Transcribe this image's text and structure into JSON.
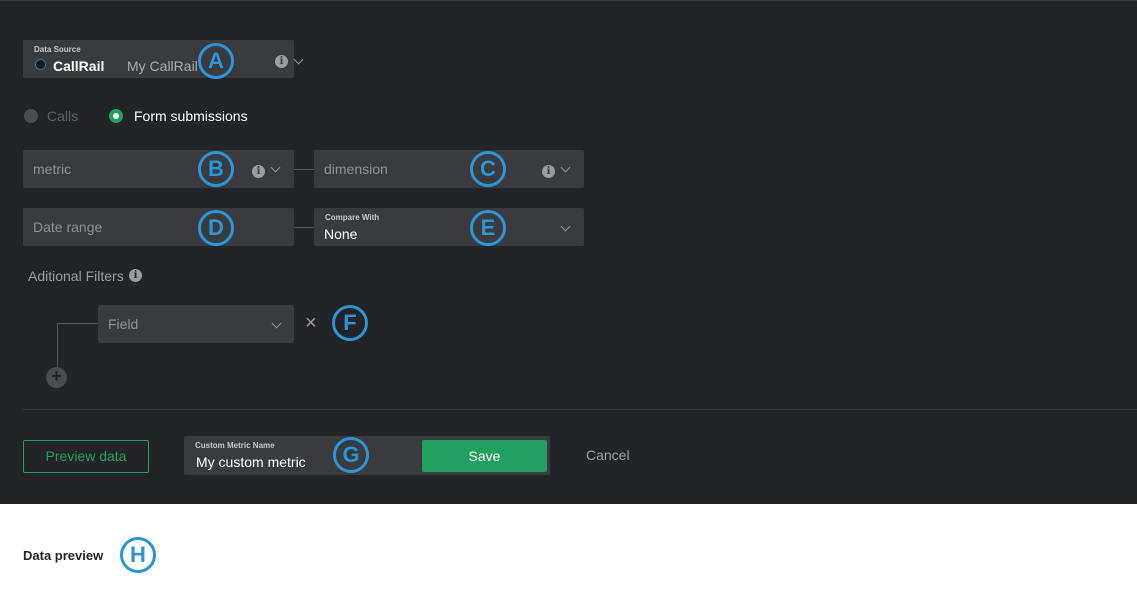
{
  "data_source": {
    "label": "Data Source",
    "provider": "CallRail",
    "account": "My CallRail",
    "badge": "A"
  },
  "source_type": {
    "options": [
      {
        "label": "Calls",
        "selected": false
      },
      {
        "label": "Form submissions",
        "selected": true
      }
    ]
  },
  "metric": {
    "placeholder": "metric",
    "badge": "B"
  },
  "dimension": {
    "placeholder": "dimension",
    "badge": "C"
  },
  "date_range": {
    "placeholder": "Date range",
    "badge": "D"
  },
  "compare_with": {
    "label": "Compare With",
    "value": "None",
    "badge": "E"
  },
  "filters": {
    "title": "Aditional Filters",
    "field_placeholder": "Field",
    "remove_symbol": "×",
    "add_symbol": "+",
    "badge": "F"
  },
  "footer": {
    "preview_label": "Preview data",
    "name_label": "Custom Metric Name",
    "name_value": "My custom metric",
    "save_label": "Save",
    "cancel_label": "Cancel",
    "badge": "G"
  },
  "preview_section": {
    "title": "Data preview",
    "badge": "H"
  },
  "colors": {
    "panel_bg": "#222427",
    "field_bg": "#393b3e",
    "accent_green": "#1fa060",
    "badge_blue": "#2b95d6"
  }
}
